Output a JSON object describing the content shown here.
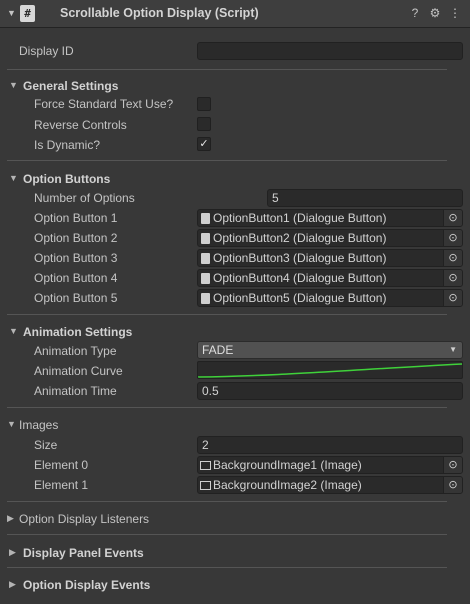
{
  "header": {
    "title": "Scrollable Option Display (Script)",
    "script_icon": "#",
    "help_icon": "?",
    "preset_icon": "⚙",
    "menu_icon": "⋮"
  },
  "display_id": {
    "label": "Display ID",
    "value": ""
  },
  "general": {
    "title": "General Settings",
    "force_standard": {
      "label": "Force Standard Text Use?",
      "checked": false
    },
    "reverse_controls": {
      "label": "Reverse Controls",
      "checked": false
    },
    "is_dynamic": {
      "label": "Is Dynamic?",
      "checked": true,
      "mark": "✓"
    }
  },
  "option_buttons": {
    "title": "Option Buttons",
    "count_label": "Number of Options",
    "count_value": "5",
    "items": [
      {
        "label": "Option Button 1",
        "value": "OptionButton1 (Dialogue Button)"
      },
      {
        "label": "Option Button 2",
        "value": "OptionButton2 (Dialogue Button)"
      },
      {
        "label": "Option Button 3",
        "value": "OptionButton3 (Dialogue Button)"
      },
      {
        "label": "Option Button 4",
        "value": "OptionButton4 (Dialogue Button)"
      },
      {
        "label": "Option Button 5",
        "value": "OptionButton5 (Dialogue Button)"
      }
    ]
  },
  "animation": {
    "title": "Animation Settings",
    "type_label": "Animation Type",
    "type_value": "FADE",
    "curve_label": "Animation Curve",
    "curve_color": "#3fd13a",
    "time_label": "Animation Time",
    "time_value": "0.5"
  },
  "images": {
    "title": "Images",
    "size_label": "Size",
    "size_value": "2",
    "items": [
      {
        "label": "Element 0",
        "value": "BackgroundImage1 (Image)"
      },
      {
        "label": "Element 1",
        "value": "BackgroundImage2 (Image)"
      }
    ]
  },
  "collapsed": {
    "listeners": "Option Display Listeners",
    "panel_events": "Display Panel Events",
    "option_events": "Option Display Events"
  },
  "colors": {
    "background": "#383838",
    "field": "#2a2a2a",
    "accent_curve": "#3fd13a"
  }
}
